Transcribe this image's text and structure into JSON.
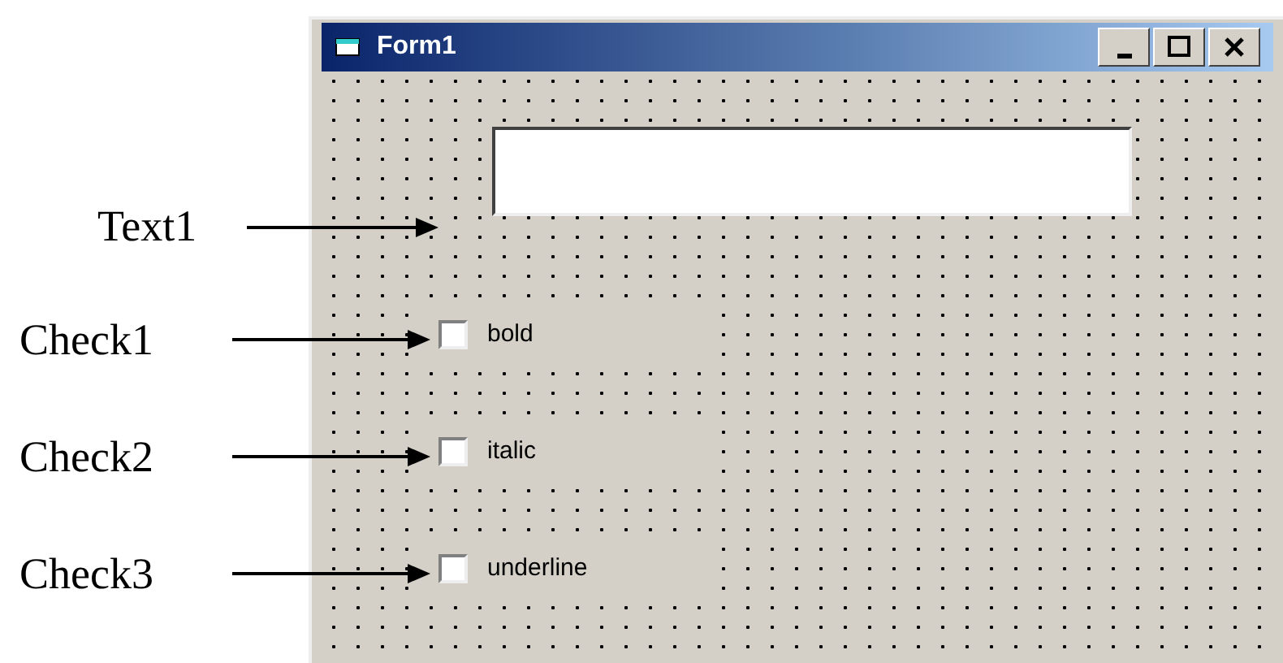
{
  "window": {
    "title": "Form1"
  },
  "textbox": {
    "annotation": "Text1"
  },
  "checkboxes": [
    {
      "caption": "bold",
      "annotation": "Check1",
      "checked": false
    },
    {
      "caption": "italic",
      "annotation": "Check2",
      "checked": false
    },
    {
      "caption": "underline",
      "annotation": "Check3",
      "checked": false
    }
  ]
}
